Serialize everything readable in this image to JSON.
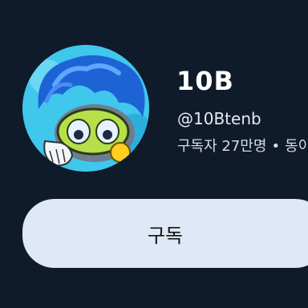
{
  "channel": {
    "name": "10B",
    "handle": "@10Btenb",
    "subscribers": "구독자 27만명",
    "separator": "•",
    "videos_truncated": "동이"
  },
  "subscribe_label": "구독",
  "colors": {
    "background": "#0f1a2b",
    "button_bg": "#dfe8f6",
    "avatar_bg": "#3ec6e8"
  }
}
